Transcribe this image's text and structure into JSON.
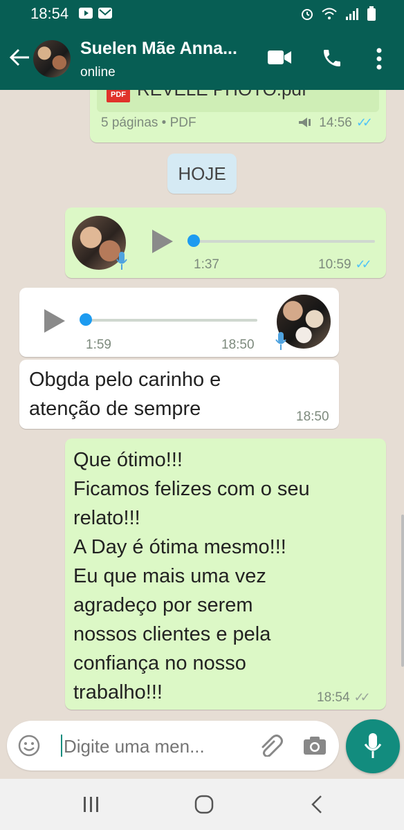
{
  "status_bar": {
    "time": "18:54"
  },
  "header": {
    "contact_name": "Suelen Mãe Anna...",
    "status": "online"
  },
  "messages": {
    "pdf": {
      "filename": "REVELE PHOTO.pdf",
      "pdf_badge": "PDF",
      "details": "5 páginas • PDF",
      "time": "14:56"
    },
    "date_divider": "HOJE",
    "voice_out": {
      "duration": "1:37",
      "time": "10:59",
      "progress": 0
    },
    "voice_in": {
      "duration": "1:59",
      "time": "18:50",
      "progress": 0
    },
    "text_in": {
      "lines": [
        "Obgda pelo carinho e",
        "atenção de sempre"
      ],
      "time": "18:50"
    },
    "text_out": {
      "lines": [
        "Que ótimo!!!",
        "Ficamos felizes com o seu",
        "relato!!!",
        "A Day é ótima mesmo!!!",
        "Eu que mais uma vez",
        "agradeço por serem",
        "nossos clientes e pela",
        "confiança no nosso",
        "trabalho!!!"
      ],
      "time": "18:54"
    }
  },
  "input": {
    "placeholder": "Digite uma men..."
  },
  "colors": {
    "header": "#075e54",
    "outgoing_bubble": "#dcf8c6",
    "incoming_bubble": "#ffffff",
    "accent": "#128c7e",
    "read_ticks": "#4fc3f7"
  },
  "icons": [
    "back-arrow-icon",
    "video-call-icon",
    "phone-icon",
    "more-options-icon",
    "emoji-icon",
    "attach-icon",
    "camera-icon",
    "mic-icon",
    "play-icon",
    "pdf-icon"
  ]
}
